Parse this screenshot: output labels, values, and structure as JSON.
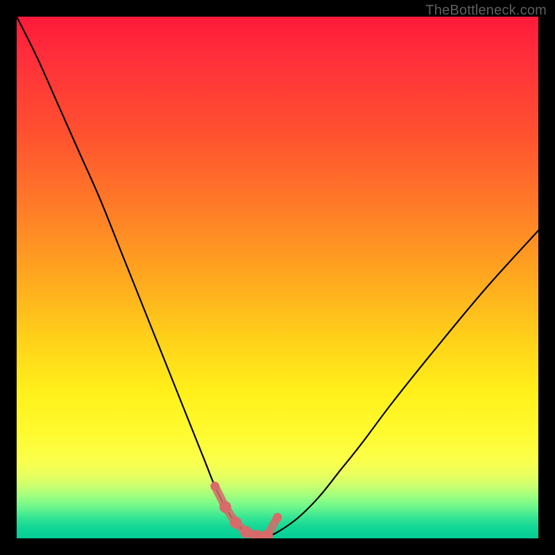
{
  "watermark": "TheBottleneck.com",
  "colors": {
    "curve_stroke": "#000000",
    "marker_fill": "#d86a6a",
    "marker_stroke": "#c95858",
    "frame": "#000000"
  },
  "chart_data": {
    "type": "line",
    "title": "",
    "xlabel": "",
    "ylabel": "",
    "xlim": [
      0,
      100
    ],
    "ylim": [
      0,
      100
    ],
    "grid": false,
    "series": [
      {
        "name": "bottleneck-curve",
        "x": [
          0,
          4,
          8,
          12,
          16,
          20,
          24,
          28,
          32,
          36,
          38,
          40,
          42,
          44,
          46,
          48,
          50,
          54,
          58,
          62,
          66,
          72,
          80,
          90,
          100
        ],
        "values": [
          100,
          92,
          83,
          74,
          65,
          55,
          45,
          35,
          25,
          15,
          10,
          6,
          3,
          1.2,
          0.5,
          0.5,
          1.2,
          4,
          8,
          13,
          18,
          26,
          36,
          48,
          59
        ]
      }
    ],
    "basin_markers": {
      "x": [
        38,
        40,
        42,
        44,
        46,
        48,
        50
      ],
      "y": [
        10,
        6,
        3,
        1.2,
        0.5,
        0.5,
        4
      ],
      "count": 7
    },
    "notes": "Values are estimated visually; chart has no axis tick labels."
  }
}
